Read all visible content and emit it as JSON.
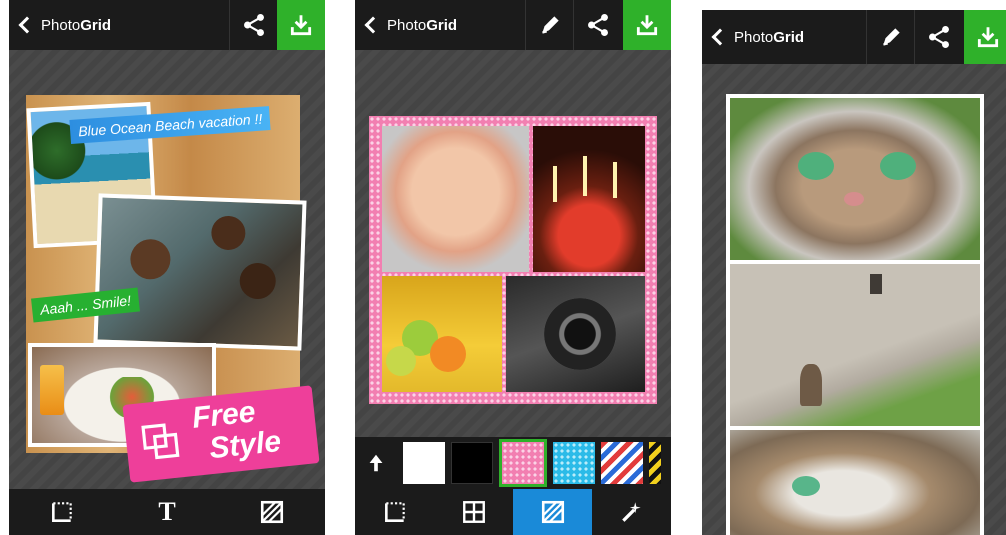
{
  "colors": {
    "green": "#2fb12a",
    "topbar": "#1b1b1b",
    "active_tab": "#1a8ad8",
    "pink_border": "#f27fb1"
  },
  "app": {
    "title_light": "Photo",
    "title_bold": "Grid"
  },
  "screen1": {
    "caption_top": "Blue Ocean Beach vacation !!",
    "caption_mid": "Aaah ... Smile!",
    "badge_line1": "Free",
    "badge_line2": "Style",
    "bottom_icons": [
      "crop-icon",
      "text-icon",
      "background-icon"
    ],
    "text_tool_glyph": "T"
  },
  "screen2": {
    "swatches": [
      "#ffffff",
      "#000000",
      "pink-dots",
      "cyan-dots",
      "stripes",
      "yellow-black"
    ],
    "selected_swatch": 2,
    "bottom_icons": [
      "crop-icon",
      "grid-layout-icon",
      "background-icon",
      "magic-wand-icon"
    ],
    "active_tab": 2
  },
  "screen3": {
    "photos": [
      "cat-closeup",
      "cats-on-path",
      "cat-face"
    ]
  }
}
